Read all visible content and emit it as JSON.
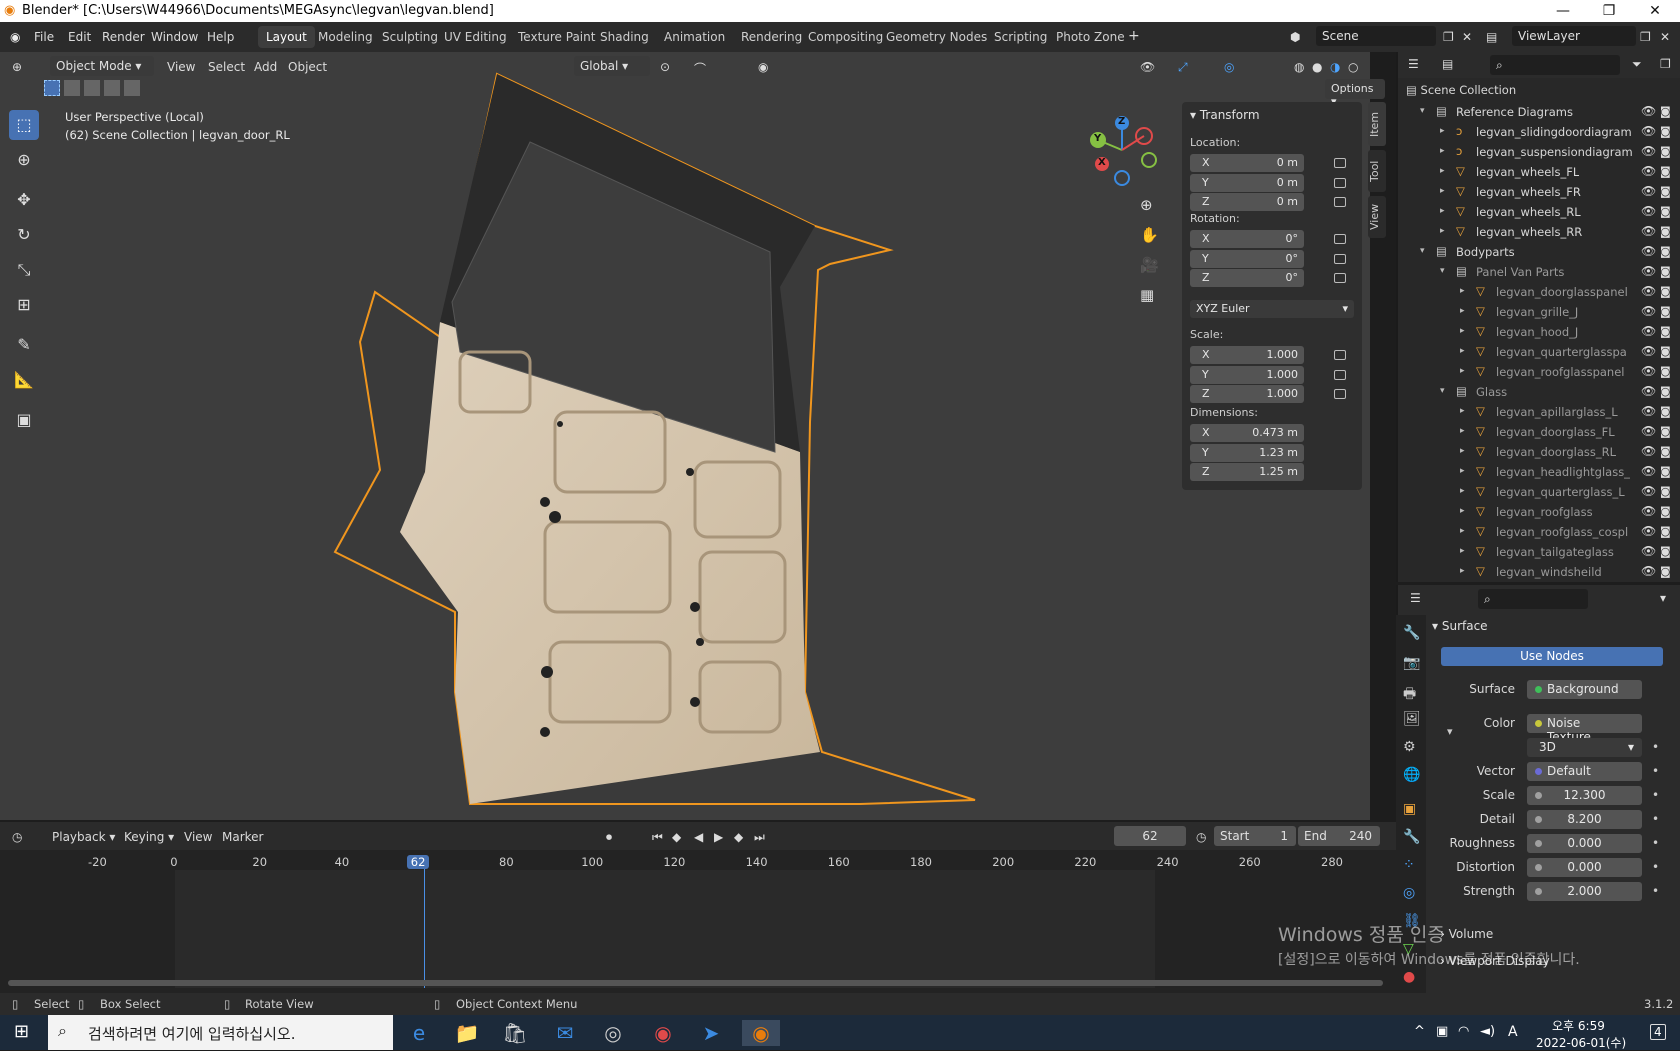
{
  "window": {
    "title": "Blender* [C:\\Users\\W44966\\Documents\\MEGAsync\\legvan\\legvan.blend]"
  },
  "menu": {
    "file": "File",
    "edit": "Edit",
    "render": "Render",
    "window": "Window",
    "help": "Help"
  },
  "workspaces": [
    "Layout",
    "Modeling",
    "Sculpting",
    "UV Editing",
    "Texture Paint",
    "Shading",
    "Animation",
    "Rendering",
    "Compositing",
    "Geometry Nodes",
    "Scripting",
    "Photo Zone"
  ],
  "scene": {
    "name": "Scene",
    "view_layer": "ViewLayer"
  },
  "viewport": {
    "mode": "Object Mode",
    "menus": {
      "view": "View",
      "select": "Select",
      "add": "Add",
      "object": "Object"
    },
    "orientation": "Global",
    "options": "Options",
    "info_line1": "User Perspective (Local)",
    "info_line2": "(62) Scene Collection | legvan_door_RL"
  },
  "gizmo": {
    "x": "X",
    "y": "Y",
    "z": "Z"
  },
  "npanel": {
    "title": "Transform",
    "location_label": "Location:",
    "location": [
      {
        "axis": "X",
        "value": "0 m"
      },
      {
        "axis": "Y",
        "value": "0 m"
      },
      {
        "axis": "Z",
        "value": "0 m"
      }
    ],
    "rotation_label": "Rotation:",
    "rotation": [
      {
        "axis": "X",
        "value": "0°"
      },
      {
        "axis": "Y",
        "value": "0°"
      },
      {
        "axis": "Z",
        "value": "0°"
      }
    ],
    "rotation_mode": "XYZ Euler",
    "scale_label": "Scale:",
    "scale": [
      {
        "axis": "X",
        "value": "1.000"
      },
      {
        "axis": "Y",
        "value": "1.000"
      },
      {
        "axis": "Z",
        "value": "1.000"
      }
    ],
    "dimensions_label": "Dimensions:",
    "dimensions": [
      {
        "axis": "X",
        "value": "0.473 m"
      },
      {
        "axis": "Y",
        "value": "1.23 m"
      },
      {
        "axis": "Z",
        "value": "1.25 m"
      }
    ],
    "tabs": {
      "item": "Item",
      "tool": "Tool",
      "view": "View"
    }
  },
  "outliner": {
    "root": "Scene Collection",
    "items": [
      {
        "label": "Reference Diagrams",
        "depth": 1,
        "kind": "collection"
      },
      {
        "label": "legvan_slidingdoordiagram",
        "depth": 2,
        "kind": "object"
      },
      {
        "label": "legvan_suspensiondiagram",
        "depth": 2,
        "kind": "object"
      },
      {
        "label": "legvan_wheels_FL",
        "depth": 2,
        "kind": "mesh"
      },
      {
        "label": "legvan_wheels_FR",
        "depth": 2,
        "kind": "mesh"
      },
      {
        "label": "legvan_wheels_RL",
        "depth": 2,
        "kind": "mesh"
      },
      {
        "label": "legvan_wheels_RR",
        "depth": 2,
        "kind": "mesh"
      },
      {
        "label": "Bodyparts",
        "depth": 1,
        "kind": "collection"
      },
      {
        "label": "Panel Van Parts",
        "depth": 2,
        "kind": "collection-dim"
      },
      {
        "label": "legvan_doorglasspanel",
        "depth": 3,
        "kind": "mesh-dim"
      },
      {
        "label": "legvan_grille_J",
        "depth": 3,
        "kind": "mesh-dim"
      },
      {
        "label": "legvan_hood_J",
        "depth": 3,
        "kind": "mesh-dim"
      },
      {
        "label": "legvan_quarterglasspa",
        "depth": 3,
        "kind": "mesh-dim"
      },
      {
        "label": "legvan_roofglasspanel",
        "depth": 3,
        "kind": "mesh-dim"
      },
      {
        "label": "Glass",
        "depth": 2,
        "kind": "collection-dim"
      },
      {
        "label": "legvan_apillarglass_L",
        "depth": 3,
        "kind": "mesh-dim"
      },
      {
        "label": "legvan_doorglass_FL",
        "depth": 3,
        "kind": "mesh-dim"
      },
      {
        "label": "legvan_doorglass_RL",
        "depth": 3,
        "kind": "mesh-dim"
      },
      {
        "label": "legvan_headlightglass_",
        "depth": 3,
        "kind": "mesh-dim"
      },
      {
        "label": "legvan_quarterglass_L",
        "depth": 3,
        "kind": "mesh-dim"
      },
      {
        "label": "legvan_roofglass",
        "depth": 3,
        "kind": "mesh-dim"
      },
      {
        "label": "legvan_roofglass_cospl",
        "depth": 3,
        "kind": "mesh-dim"
      },
      {
        "label": "legvan_tailgateglass",
        "depth": 3,
        "kind": "mesh-dim"
      },
      {
        "label": "legvan_windsheild",
        "depth": 3,
        "kind": "mesh-dim"
      }
    ]
  },
  "properties": {
    "surface_header": "Surface",
    "use_nodes": "Use Nodes",
    "fields": [
      {
        "label": "Surface",
        "value": "Background",
        "dot": "#3fbf5a"
      },
      {
        "label": "Color",
        "value": "Noise Texture",
        "dot": "#c8c83c"
      },
      {
        "label": "",
        "value": "3D",
        "dot": ""
      },
      {
        "label": "Vector",
        "value": "Default",
        "dot": "#6b6bd6"
      },
      {
        "label": "Scale",
        "value": "12.300",
        "dot": "#a0a0a0"
      },
      {
        "label": "Detail",
        "value": "8.200",
        "dot": "#a0a0a0"
      },
      {
        "label": "Roughness",
        "value": "0.000",
        "dot": "#a0a0a0"
      },
      {
        "label": "Distortion",
        "value": "0.000",
        "dot": "#a0a0a0"
      },
      {
        "label": "Strength",
        "value": "2.000",
        "dot": "#a0a0a0"
      }
    ],
    "volume": "Volume",
    "viewport_display": "Viewport Display"
  },
  "timeline": {
    "playback": "Playback",
    "keying": "Keying",
    "view": "View",
    "marker": "Marker",
    "current_frame": "62",
    "start_label": "Start",
    "start": "1",
    "end_label": "End",
    "end": "240",
    "ticks": [
      "-20",
      "0",
      "20",
      "40",
      "62",
      "80",
      "100",
      "120",
      "140",
      "160",
      "180",
      "200",
      "220",
      "240",
      "260",
      "280"
    ]
  },
  "statusbar": {
    "select": "Select",
    "box_select": "Box Select",
    "rotate_view": "Rotate View",
    "context_menu": "Object Context Menu",
    "version": "3.1.2"
  },
  "watermark": {
    "line1": "Windows 정품 인증",
    "line2": "[설정]으로 이동하여 Windows를 정품 인증합니다."
  },
  "taskbar": {
    "search_placeholder": "검색하려면 여기에 입력하십시오.",
    "time": "오후 6:59",
    "date": "2022-06-01(수)",
    "lang": "A",
    "notif": "4"
  }
}
